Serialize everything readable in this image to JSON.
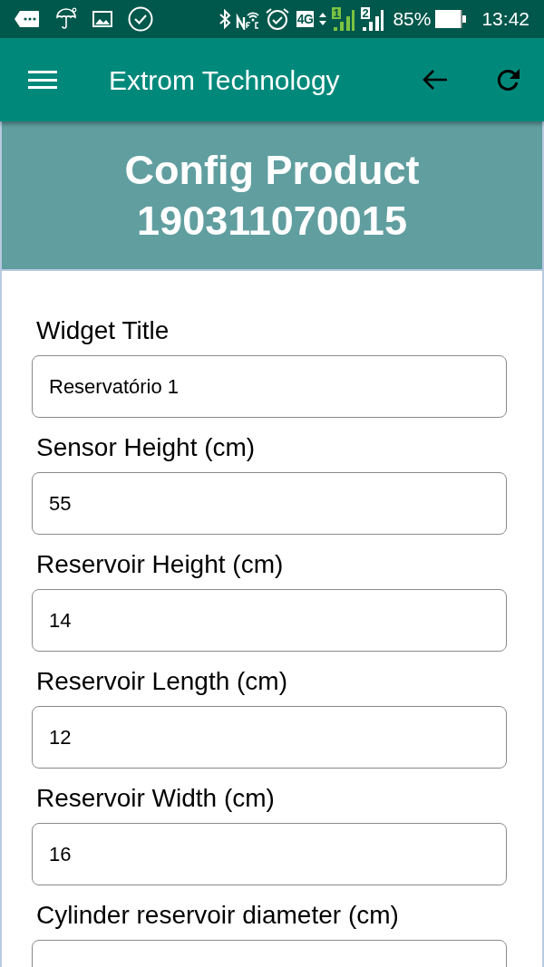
{
  "status_bar": {
    "network": "4G",
    "sims": [
      {
        "label": "1",
        "color": "#7cc242"
      },
      {
        "label": "2",
        "color": "#ffffff"
      }
    ],
    "battery": "85%",
    "time": "13:42"
  },
  "app_bar": {
    "title": "Extrom Technology"
  },
  "header": {
    "title": "Config Product 190311070015"
  },
  "fields": [
    {
      "label": "Widget Title",
      "value": "Reservatório 1"
    },
    {
      "label": "Sensor Height (cm)",
      "value": "55"
    },
    {
      "label": "Reservoir Height (cm)",
      "value": "14"
    },
    {
      "label": "Reservoir Length (cm)",
      "value": "12"
    },
    {
      "label": "Reservoir Width (cm)",
      "value": "16"
    },
    {
      "label": "Cylinder reservoir diameter (cm)"
    }
  ]
}
